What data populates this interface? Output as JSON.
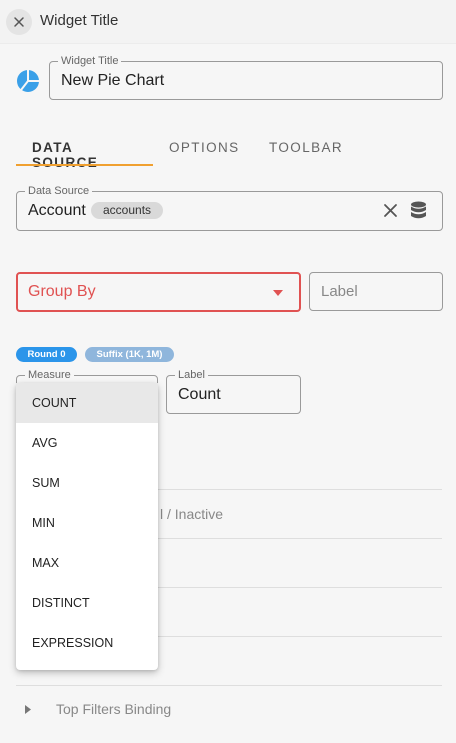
{
  "header": {
    "title": "Widget Title"
  },
  "widget_title_field": {
    "legend": "Widget Title",
    "value": "New Pie Chart"
  },
  "tabs": [
    {
      "label": "DATA SOURCE"
    },
    {
      "label": "OPTIONS"
    },
    {
      "label": "TOOLBAR"
    }
  ],
  "data_source": {
    "legend": "Data Source",
    "value": "Account",
    "chip": "accounts"
  },
  "group_by": {
    "placeholder": "Group By"
  },
  "group_label": {
    "placeholder": "Label"
  },
  "badges": {
    "round": "Round 0",
    "suffix": "Suffix (1K, 1M)"
  },
  "measure": {
    "legend": "Measure"
  },
  "measure_label": {
    "legend": "Label",
    "value": "Count"
  },
  "background_rows": {
    "status_suffix": "l / Inactive",
    "top_filters": "Top Filters Binding"
  },
  "dropdown": {
    "options": [
      "COUNT",
      "AVG",
      "SUM",
      "MIN",
      "MAX",
      "DISTINCT",
      "EXPRESSION"
    ],
    "selected": "COUNT"
  },
  "colors": {
    "accent": "#f0a030",
    "error": "#e05252",
    "pie_icon": "#3aa0e8",
    "badge_round": "#2b95ea",
    "badge_suffix": "#8fb6dc"
  }
}
